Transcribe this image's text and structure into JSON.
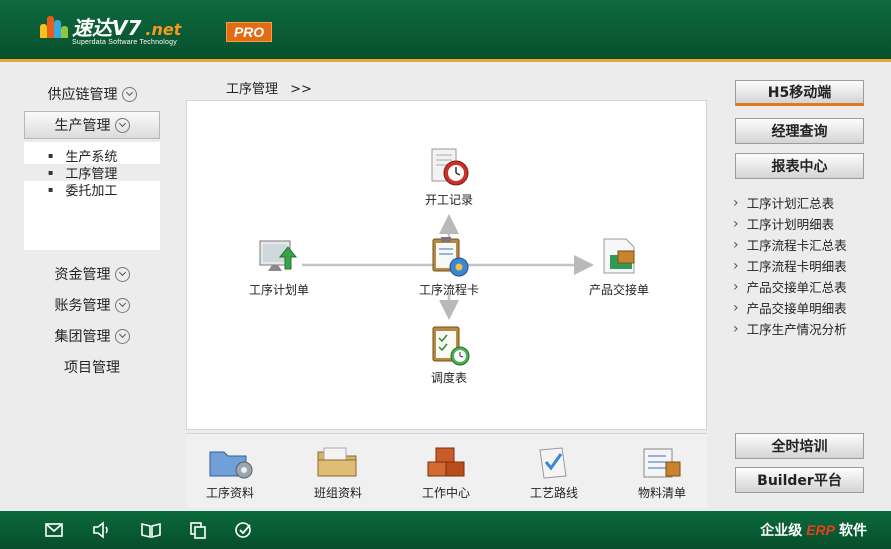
{
  "header": {
    "logo_name": "速达V7",
    "logo_suffix": ".net",
    "logo_subtitle": "Superdata Software Technology",
    "badge": "PRO"
  },
  "sidebar": {
    "items": [
      {
        "label": "供应链管理"
      },
      {
        "label": "生产管理"
      },
      {
        "label": "资金管理"
      },
      {
        "label": "账务管理"
      },
      {
        "label": "集团管理"
      },
      {
        "label": "项目管理"
      }
    ],
    "submenu": [
      {
        "label": "生产系统"
      },
      {
        "label": "工序管理"
      },
      {
        "label": "委托加工"
      }
    ]
  },
  "breadcrumb": {
    "current": "工序管理",
    "separator": ">>"
  },
  "flow": {
    "nodes": {
      "start_record": "开工记录",
      "plan_sheet": "工序计划单",
      "flow_card": "工序流程卡",
      "handover": "产品交接单",
      "dispatch": "调度表"
    }
  },
  "tools": [
    {
      "label": "工序资料"
    },
    {
      "label": "班组资料"
    },
    {
      "label": "工作中心"
    },
    {
      "label": "工艺路线"
    },
    {
      "label": "物料清单"
    }
  ],
  "right": {
    "h5": "H5移动端",
    "manager_query": "经理查询",
    "report_center": "报表中心",
    "reports": [
      "工序计划汇总表",
      "工序计划明细表",
      "工序流程卡汇总表",
      "工序流程卡明细表",
      "产品交接单汇总表",
      "产品交接单明细表",
      "工序生产情况分析"
    ],
    "training": "全时培训",
    "builder": "Builder平台"
  },
  "footer": {
    "brand_prefix": "企业级",
    "brand_erp": "ERP",
    "brand_suffix": "软件",
    "icons": [
      "mail-icon",
      "volume-icon",
      "book-icon",
      "copy-icon",
      "check-icon"
    ]
  },
  "colors": {
    "header_green": "#0f6a3e",
    "accent_orange": "#e8a33a",
    "badge_orange": "#e26b14",
    "erp_red": "#e8401c"
  }
}
